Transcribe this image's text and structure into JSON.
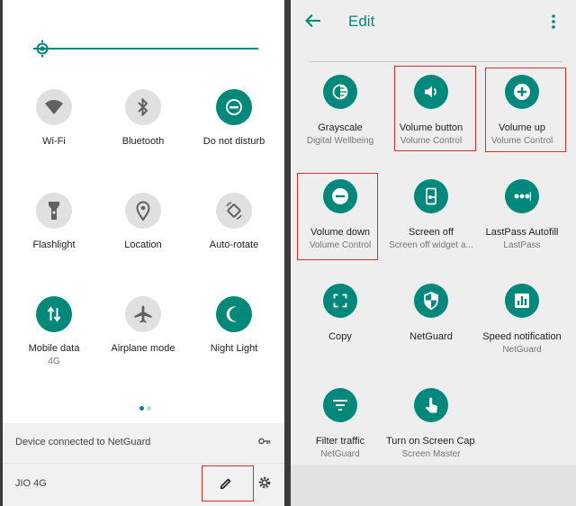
{
  "left": {
    "brightness_level": 1.0,
    "tiles": [
      {
        "label": "Wi-Fi",
        "icon": "wifi-icon",
        "state": "off",
        "sub": ""
      },
      {
        "label": "Bluetooth",
        "icon": "bluetooth-icon",
        "state": "off",
        "sub": ""
      },
      {
        "label": "Do not disturb",
        "icon": "do-not-disturb-icon",
        "state": "on",
        "sub": ""
      },
      {
        "label": "Flashlight",
        "icon": "flashlight-icon",
        "state": "off",
        "sub": ""
      },
      {
        "label": "Location",
        "icon": "location-icon",
        "state": "off",
        "sub": ""
      },
      {
        "label": "Auto-rotate",
        "icon": "auto-rotate-icon",
        "state": "off",
        "sub": ""
      },
      {
        "label": "Mobile data",
        "icon": "mobile-data-icon",
        "state": "on",
        "sub": "4G"
      },
      {
        "label": "Airplane mode",
        "icon": "airplane-icon",
        "state": "off",
        "sub": ""
      },
      {
        "label": "Night Light",
        "icon": "night-light-icon",
        "state": "on",
        "sub": ""
      }
    ],
    "page_indicator": {
      "pages": 2,
      "current": 1
    },
    "vpn_notice": "Device connected to NetGuard",
    "carrier": "JIO 4G"
  },
  "right": {
    "title": "Edit",
    "tiles": [
      {
        "label": "Grayscale",
        "sub": "Digital Wellbeing",
        "icon": "grayscale-icon",
        "highlighted": false
      },
      {
        "label": "Volume button",
        "sub": "Volume Control",
        "icon": "volume-icon",
        "highlighted": true
      },
      {
        "label": "Volume up",
        "sub": "Volume Control",
        "icon": "plus-icon",
        "highlighted": true
      },
      {
        "label": "Volume down",
        "sub": "Volume Control",
        "icon": "minus-icon",
        "highlighted": true
      },
      {
        "label": "Screen off",
        "sub": "Screen off widget a...",
        "icon": "screen-off-icon",
        "highlighted": false
      },
      {
        "label": "LastPass Autofill",
        "sub": "LastPass",
        "icon": "lastpass-icon",
        "highlighted": false
      },
      {
        "label": "Copy",
        "sub": "",
        "icon": "copy-icon",
        "highlighted": false
      },
      {
        "label": "NetGuard",
        "sub": "",
        "icon": "shield-icon",
        "highlighted": false
      },
      {
        "label": "Speed notification",
        "sub": "NetGuard",
        "icon": "bar-chart-icon",
        "highlighted": false
      },
      {
        "label": "Filter traffic",
        "sub": "NetGuard",
        "icon": "filter-icon",
        "highlighted": false
      },
      {
        "label": "Turn on Screen Cap...",
        "sub": "Screen Master",
        "icon": "touch-icon",
        "highlighted": false
      }
    ]
  },
  "colors": {
    "accent": "#00897b",
    "highlight": "#d32f2f",
    "tile_off": "#e0e0e0"
  }
}
